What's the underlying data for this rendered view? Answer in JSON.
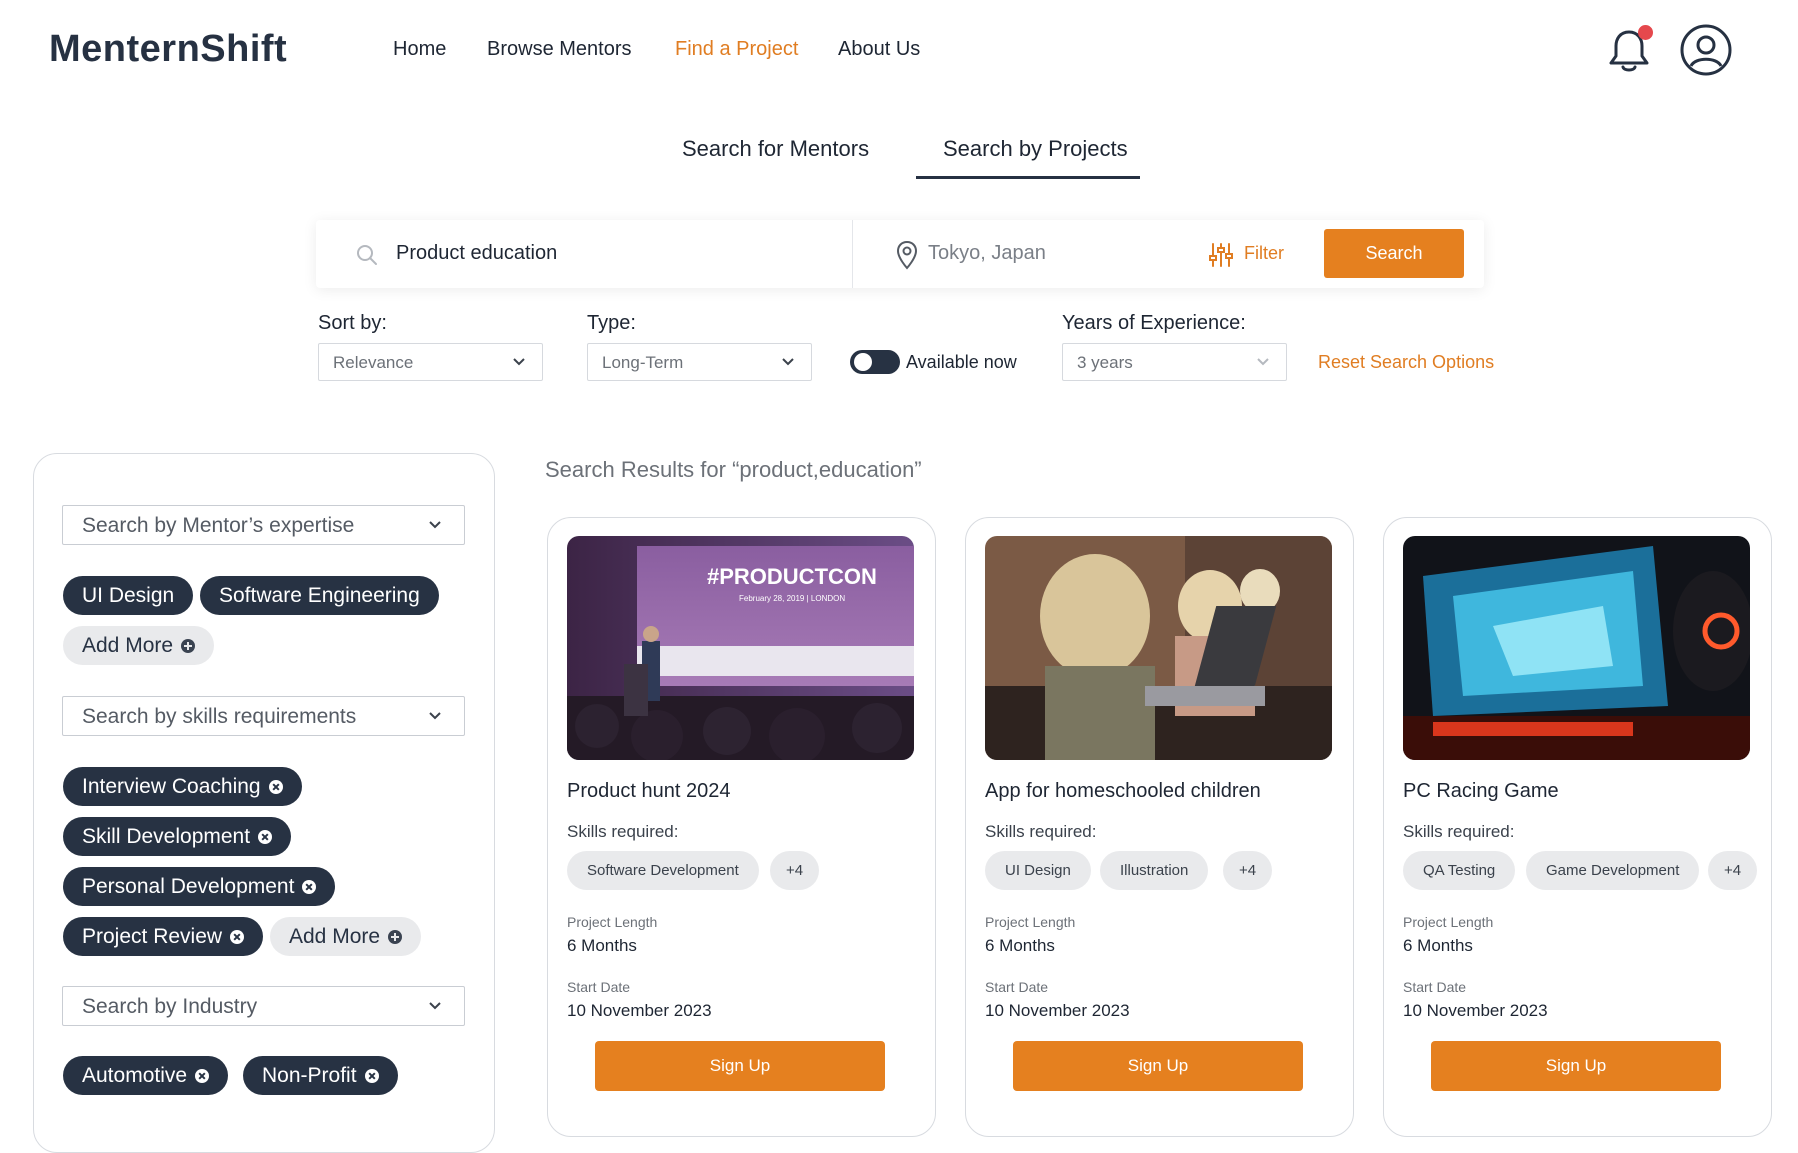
{
  "header": {
    "logo": "MenternShift",
    "nav": [
      {
        "label": "Home",
        "active": false
      },
      {
        "label": "Browse Mentors",
        "active": false
      },
      {
        "label": "Find a Project",
        "active": true
      },
      {
        "label": "About Us",
        "active": false
      }
    ],
    "icons": [
      "bell-icon",
      "user-avatar-icon"
    ],
    "accent_color": "#e07d22"
  },
  "tabs": [
    {
      "label": "Search for Mentors",
      "selected": false
    },
    {
      "label": "Search by Projects",
      "selected": true
    }
  ],
  "search": {
    "query": "Product education",
    "location": "Tokyo, Japan",
    "filter_label": "Filter",
    "button_label": "Search"
  },
  "filters": {
    "sort_label": "Sort by:",
    "sort_value": "Relevance",
    "type_label": "Type:",
    "type_value": "Long-Term",
    "available_label": "Available now",
    "available_on": false,
    "experience_label": "Years of Experience:",
    "experience_value": "3 years",
    "reset_label": "Reset Search Options"
  },
  "sidebar": {
    "expertise": {
      "placeholder": "Search by Mentor’s expertise",
      "chips": [
        "UI Design",
        "Software Engineering"
      ],
      "add_more": "Add More"
    },
    "skills": {
      "placeholder": "Search by skills requirements",
      "chips": [
        "Interview Coaching",
        "Skill Development",
        "Personal Development",
        "Project Review"
      ],
      "add_more": "Add More"
    },
    "industry": {
      "placeholder": "Search by Industry",
      "chips": [
        "Automotive",
        "Non-Profit"
      ]
    }
  },
  "results": {
    "title": "Search Results for “product,education”",
    "cards": [
      {
        "title": "Product hunt 2024",
        "skills_label": "Skills required:",
        "skills": [
          "Software Development",
          "+4"
        ],
        "length_label": "Project Length",
        "length": "6 Months",
        "start_label": "Start Date",
        "start": "10 November 2023",
        "button": "Sign Up",
        "image_banner": "#PRODUCTCON",
        "image_subtitle": "February 28, 2019 | LONDON"
      },
      {
        "title": "App for homeschooled children",
        "skills_label": "Skills required:",
        "skills": [
          "UI Design",
          "Illustration",
          "+4"
        ],
        "length_label": "Project Length",
        "length": "6 Months",
        "start_label": "Start Date",
        "start": "10 November 2023",
        "button": "Sign Up"
      },
      {
        "title": "PC Racing Game",
        "skills_label": "Skills required:",
        "skills": [
          "QA Testing",
          "Game Development",
          "+4"
        ],
        "length_label": "Project Length",
        "length": "6 Months",
        "start_label": "Start Date",
        "start": "10 November 2023",
        "button": "Sign Up"
      }
    ]
  }
}
